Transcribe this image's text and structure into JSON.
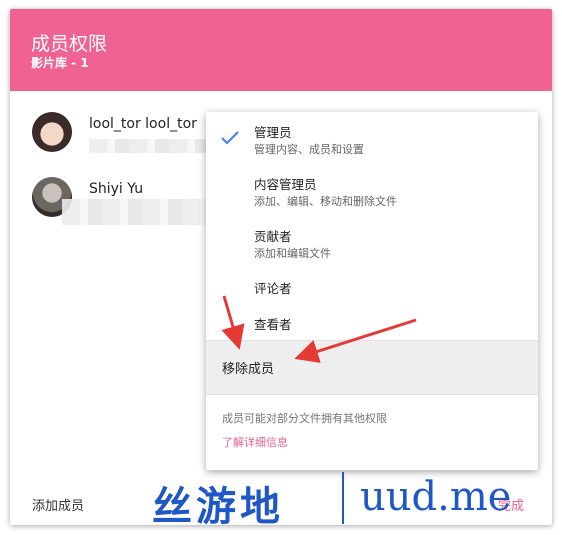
{
  "dialog": {
    "title": "成员权限",
    "subtitle": "影片库 - 1"
  },
  "members": [
    {
      "name": "lool_tor lool_tor"
    },
    {
      "name": "Shiyi Yu"
    }
  ],
  "footer": {
    "add_member_label": "添加成员",
    "done_label": "完成"
  },
  "role_menu": {
    "selected": "管理员",
    "items": [
      {
        "title": "管理员",
        "description": "管理内容、成员和设置"
      },
      {
        "title": "内容管理员",
        "description": "添加、编辑、移动和删除文件"
      },
      {
        "title": "贡献者",
        "description": "添加和编辑文件"
      },
      {
        "title": "评论者",
        "description": ""
      },
      {
        "title": "查看者",
        "description": ""
      }
    ],
    "remove_label": "移除成员",
    "note": "成员可能对部分文件拥有其他权限",
    "learn_more": "了解详细信息"
  },
  "watermark": {
    "cn": "丝游地",
    "en": "uud.me"
  },
  "colors": {
    "accent": "#f06291",
    "check": "#4285f4",
    "arrow": "#e53935",
    "watermark": "#1f57c7"
  },
  "icons": {
    "check": "check-icon"
  }
}
